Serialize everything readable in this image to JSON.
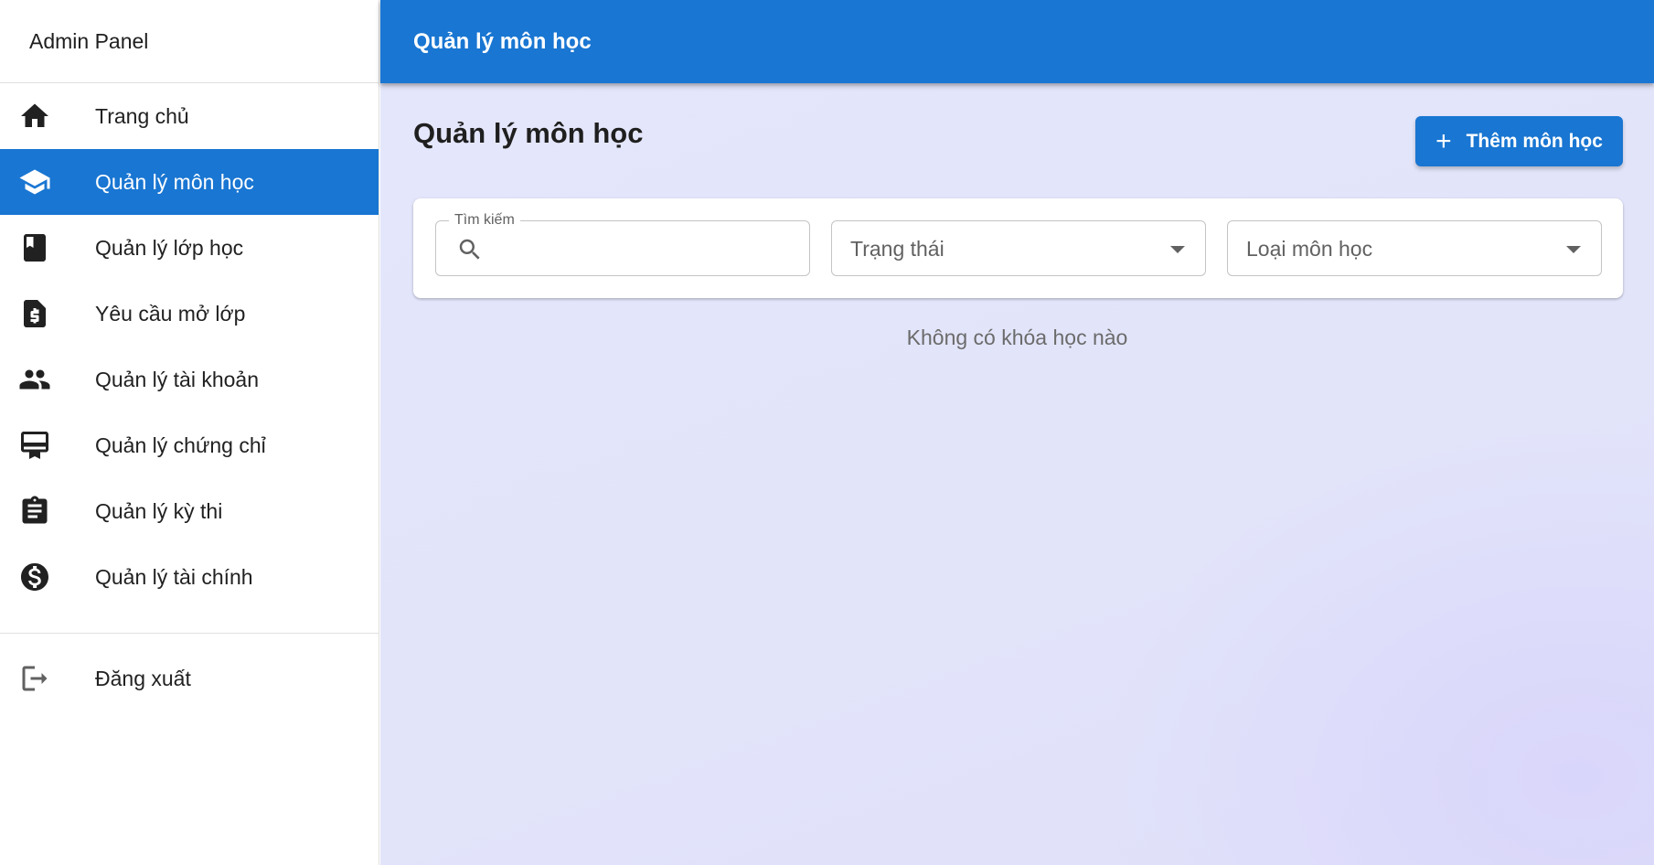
{
  "sidebar": {
    "title": "Admin Panel",
    "items": [
      {
        "label": "Trang chủ",
        "icon": "home-icon",
        "active": false
      },
      {
        "label": "Quản lý môn học",
        "icon": "school-icon",
        "active": true
      },
      {
        "label": "Quản lý lớp học",
        "icon": "book-icon",
        "active": false
      },
      {
        "label": "Yêu cầu mở lớp",
        "icon": "request-document-icon",
        "active": false
      },
      {
        "label": "Quản lý tài khoản",
        "icon": "people-icon",
        "active": false
      },
      {
        "label": "Quản lý chứng chỉ",
        "icon": "certificate-icon",
        "active": false
      },
      {
        "label": "Quản lý kỳ thi",
        "icon": "clipboard-icon",
        "active": false
      },
      {
        "label": "Quản lý tài chính",
        "icon": "dollar-icon",
        "active": false
      }
    ],
    "logout": {
      "label": "Đăng xuất",
      "icon": "logout-icon"
    }
  },
  "header": {
    "title": "Quản lý môn học"
  },
  "main": {
    "page_title": "Quản lý môn học",
    "add_button_label": "Thêm môn học",
    "filters": {
      "search_label": "Tìm kiếm",
      "search_value": "",
      "status_label": "Trạng thái",
      "type_label": "Loại môn học"
    },
    "empty_message": "Không có khóa học nào"
  },
  "colors": {
    "primary": "#1976d2",
    "background": "#e2e4fa",
    "sidebar_bg": "#ffffff"
  }
}
